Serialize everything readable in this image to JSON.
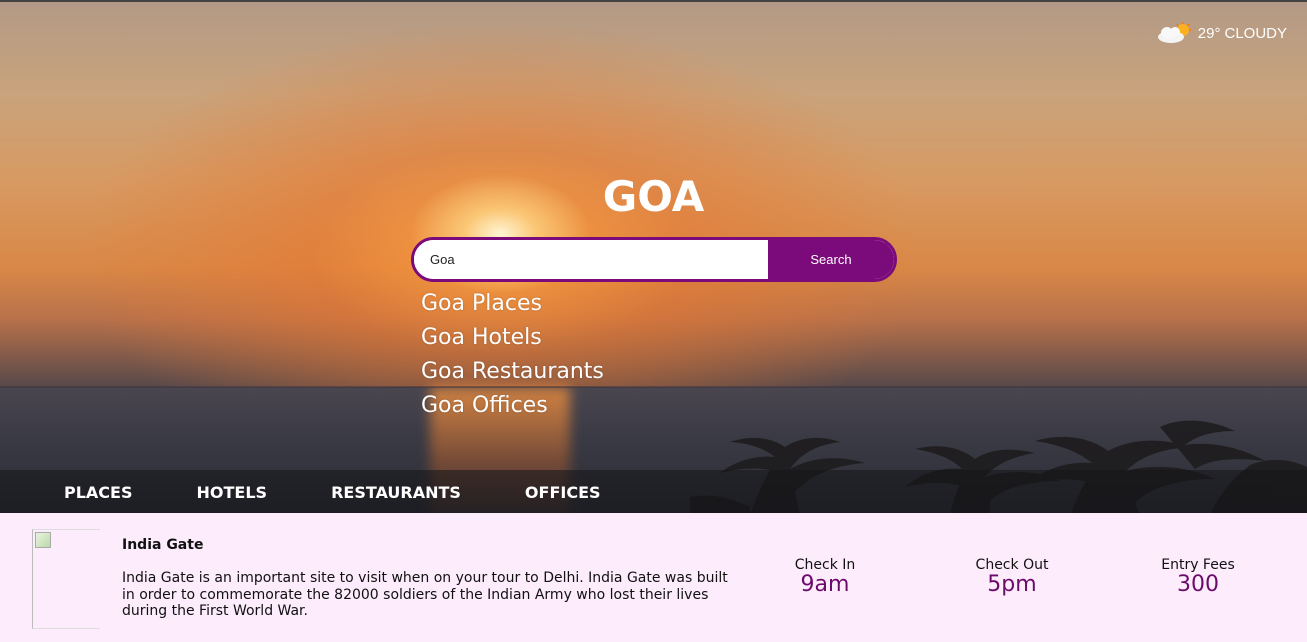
{
  "weather": {
    "temperature": "29°",
    "condition": "CLOUDY",
    "icon": "cloud-sun-icon"
  },
  "city": "GOA",
  "search": {
    "value": "Goa",
    "button_label": "Search"
  },
  "suggestions": [
    "Goa Places",
    "Goa Hotels",
    "Goa Restaurants",
    "Goa Offices"
  ],
  "tabs": [
    "PLACES",
    "HOTELS",
    "RESTAURANTS",
    "OFFICES"
  ],
  "place": {
    "name": "India Gate",
    "description": "India Gate is an important site to visit when on your tour to Delhi. India Gate was built in order to commemorate the 82000 soldiers of the Indian Army who lost their lives during the First World War.",
    "check_in_label": "Check In",
    "check_in": "9am",
    "check_out_label": "Check Out",
    "check_out": "5pm",
    "entry_fees_label": "Entry Fees",
    "entry_fees": "300"
  },
  "colors": {
    "accent": "#7b0a7b",
    "card_bg": "#fcecfc",
    "value_text": "#6c0a6c"
  }
}
